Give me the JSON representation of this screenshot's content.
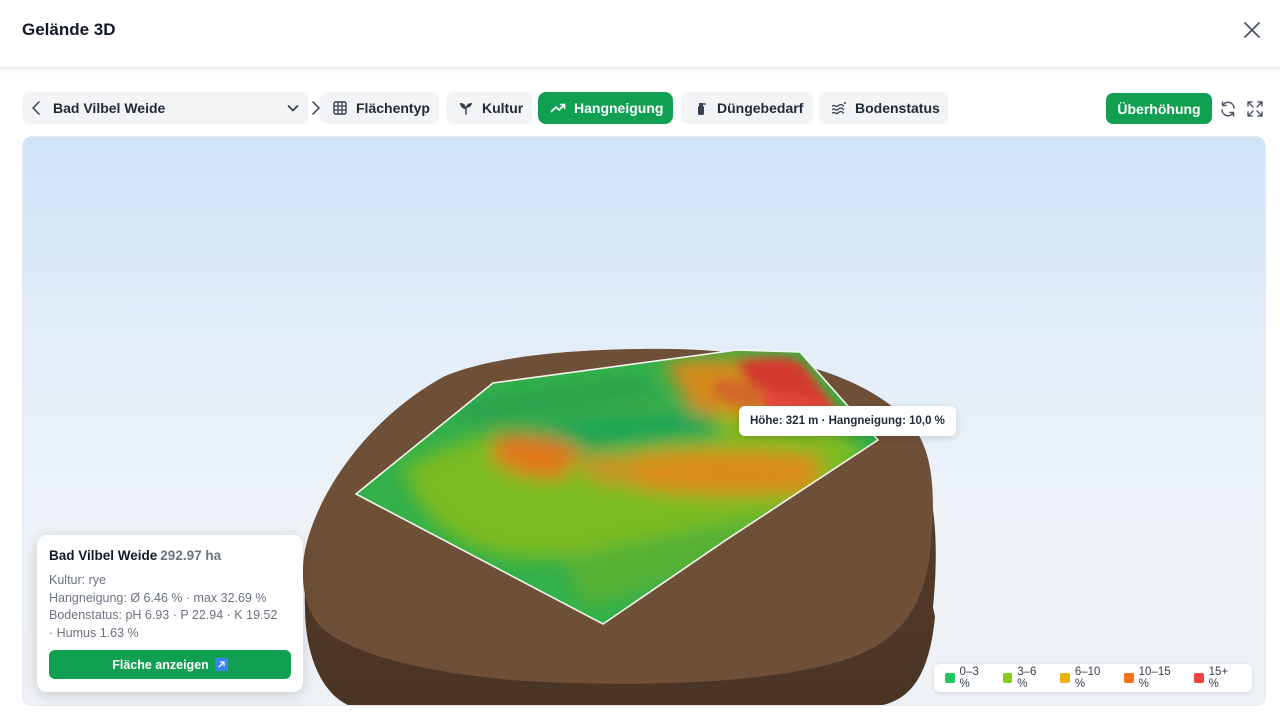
{
  "dialog": {
    "title": "Gelände 3D"
  },
  "toolbar": {
    "field": {
      "name": "Bad Vilbel Weide"
    },
    "tabs": [
      {
        "label": "Flächentyp",
        "icon": "grid-icon",
        "active": false
      },
      {
        "label": "Kultur",
        "icon": "sprout-icon",
        "active": false
      },
      {
        "label": "Hangneigung",
        "icon": "trend-up-icon",
        "active": true
      },
      {
        "label": "Düngebedarf",
        "icon": "spray-bottle-icon",
        "active": false
      },
      {
        "label": "Bodenstatus",
        "icon": "soil-waves-icon",
        "active": false
      }
    ],
    "exaggeration_label": "Überhöhung"
  },
  "tooltip": {
    "text": "Höhe: 321 m · Hangneigung: 10,0 %"
  },
  "info": {
    "name": "Bad Vilbel Weide",
    "area": "292.97 ha",
    "culture": "Kultur: rye",
    "slope": "Hangneigung: Ø 6.46 % · max 32.69 %",
    "soil_1": "Bodenstatus: pH 6.93 · P 22.94 · K 19.52",
    "soil_2": "· Humus 1.63 %",
    "button_label": "Fläche anzeigen"
  },
  "legend": [
    {
      "label": "0–3 %",
      "color": "#22c55e"
    },
    {
      "label": "3–6 %",
      "color": "#84cc16"
    },
    {
      "label": "6–10 %",
      "color": "#eab308"
    },
    {
      "label": "10–15 %",
      "color": "#f97316"
    },
    {
      "label": "15+ %",
      "color": "#ef4444"
    }
  ],
  "colors": {
    "accent": "#11a052",
    "terrain": "#6e5038"
  }
}
